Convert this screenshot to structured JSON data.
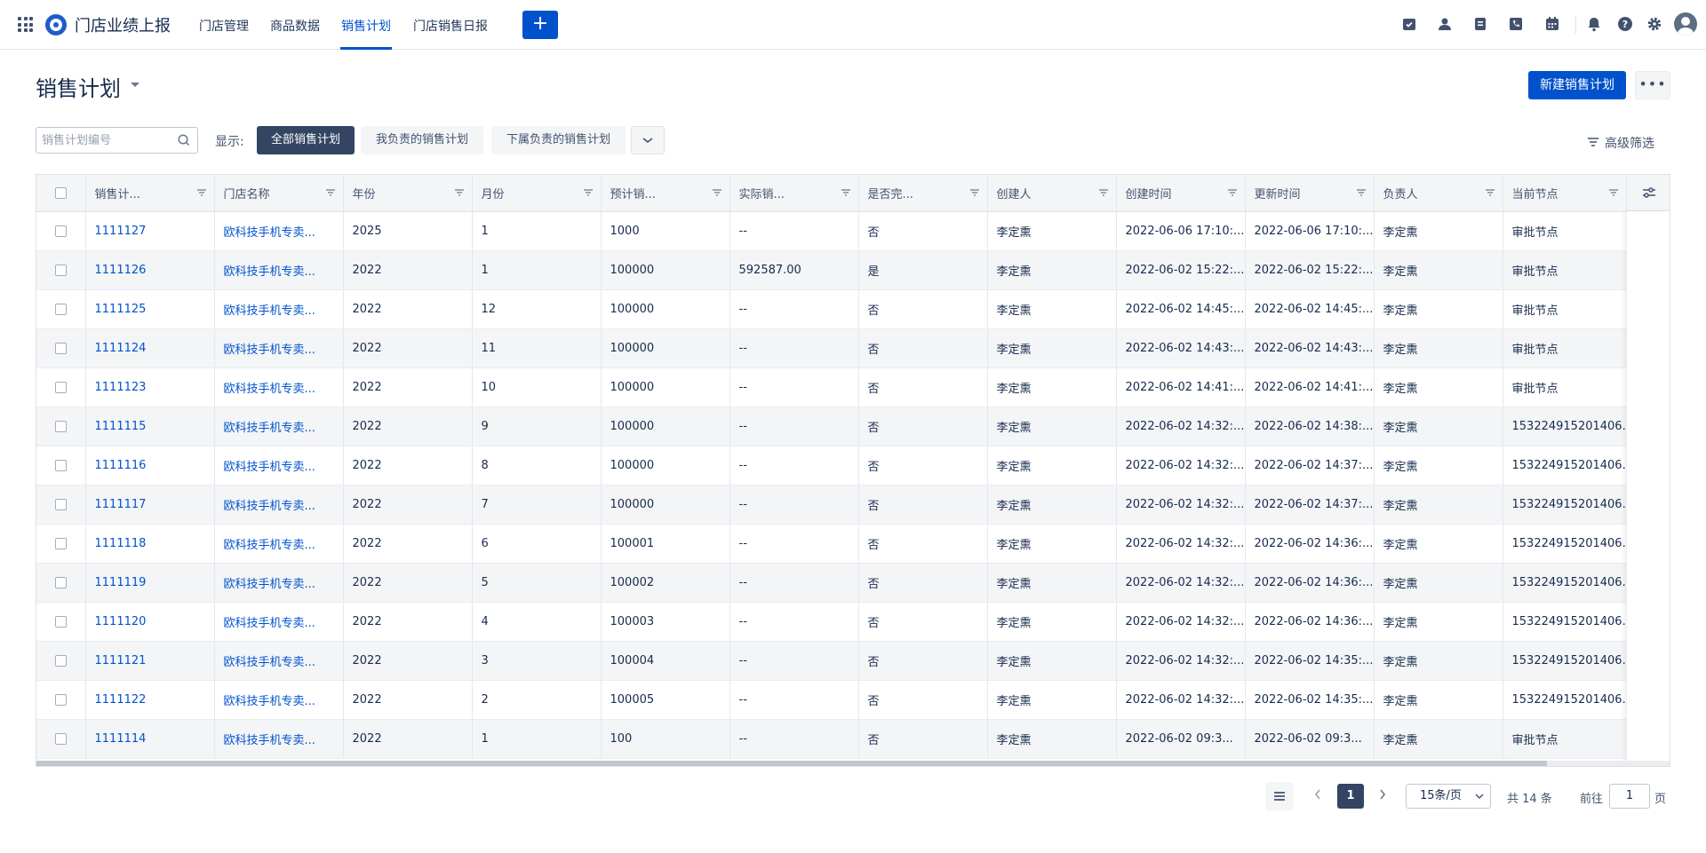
{
  "topnav": {
    "app_title": "门店业绩上报",
    "items": [
      {
        "label": "门店管理",
        "active": false
      },
      {
        "label": "商品数据",
        "active": false
      },
      {
        "label": "销售计划",
        "active": true
      },
      {
        "label": "门店销售日报",
        "active": false
      }
    ],
    "add_label": "+",
    "icons": [
      "task-icon",
      "contacts-icon",
      "document-icon",
      "phone-icon",
      "calendar-icon",
      "bell-icon",
      "help-icon",
      "settings-icon"
    ]
  },
  "header": {
    "title": "销售计划",
    "new_button": "新建销售计划",
    "more_button": "•••"
  },
  "filters": {
    "search_placeholder": "销售计划编号",
    "show_label": "显示:",
    "segments": [
      "全部销售计划",
      "我负责的销售计划",
      "下属负责的销售计划"
    ],
    "active_segment": 0,
    "advanced_filter": "高级筛选"
  },
  "table": {
    "columns": [
      "销售计...",
      "门店名称",
      "年份",
      "月份",
      "预计销...",
      "实际销...",
      "是否完...",
      "创建人",
      "创建时间",
      "更新时间",
      "负责人",
      "当前节点"
    ],
    "rows": [
      [
        "1111127",
        "欧科技手机专卖...",
        "2025",
        "1",
        "1000",
        "--",
        "否",
        "李定熏",
        "2022-06-06 17:10:...",
        "2022-06-06 17:10:...",
        "李定熏",
        "审批节点"
      ],
      [
        "1111126",
        "欧科技手机专卖...",
        "2022",
        "1",
        "100000",
        "592587.00",
        "是",
        "李定熏",
        "2022-06-02 15:22:...",
        "2022-06-02 15:22:...",
        "李定熏",
        "审批节点"
      ],
      [
        "1111125",
        "欧科技手机专卖...",
        "2022",
        "12",
        "100000",
        "--",
        "否",
        "李定熏",
        "2022-06-02 14:45:...",
        "2022-06-02 14:45:...",
        "李定熏",
        "审批节点"
      ],
      [
        "1111124",
        "欧科技手机专卖...",
        "2022",
        "11",
        "100000",
        "--",
        "否",
        "李定熏",
        "2022-06-02 14:43:...",
        "2022-06-02 14:43:...",
        "李定熏",
        "审批节点"
      ],
      [
        "1111123",
        "欧科技手机专卖...",
        "2022",
        "10",
        "100000",
        "--",
        "否",
        "李定熏",
        "2022-06-02 14:41:...",
        "2022-06-02 14:41:...",
        "李定熏",
        "审批节点"
      ],
      [
        "1111115",
        "欧科技手机专卖...",
        "2022",
        "9",
        "100000",
        "--",
        "否",
        "李定熏",
        "2022-06-02 14:32:...",
        "2022-06-02 14:38:...",
        "李定熏",
        "153224915201406..."
      ],
      [
        "1111116",
        "欧科技手机专卖...",
        "2022",
        "8",
        "100000",
        "--",
        "否",
        "李定熏",
        "2022-06-02 14:32:...",
        "2022-06-02 14:37:...",
        "李定熏",
        "153224915201406..."
      ],
      [
        "1111117",
        "欧科技手机专卖...",
        "2022",
        "7",
        "100000",
        "--",
        "否",
        "李定熏",
        "2022-06-02 14:32:...",
        "2022-06-02 14:37:...",
        "李定熏",
        "153224915201406..."
      ],
      [
        "1111118",
        "欧科技手机专卖...",
        "2022",
        "6",
        "100001",
        "--",
        "否",
        "李定熏",
        "2022-06-02 14:32:...",
        "2022-06-02 14:36:...",
        "李定熏",
        "153224915201406..."
      ],
      [
        "1111119",
        "欧科技手机专卖...",
        "2022",
        "5",
        "100002",
        "--",
        "否",
        "李定熏",
        "2022-06-02 14:32:...",
        "2022-06-02 14:36:...",
        "李定熏",
        "153224915201406..."
      ],
      [
        "1111120",
        "欧科技手机专卖...",
        "2022",
        "4",
        "100003",
        "--",
        "否",
        "李定熏",
        "2022-06-02 14:32:...",
        "2022-06-02 14:36:...",
        "李定熏",
        "153224915201406..."
      ],
      [
        "1111121",
        "欧科技手机专卖...",
        "2022",
        "3",
        "100004",
        "--",
        "否",
        "李定熏",
        "2022-06-02 14:32:...",
        "2022-06-02 14:35:...",
        "李定熏",
        "153224915201406..."
      ],
      [
        "1111122",
        "欧科技手机专卖...",
        "2022",
        "2",
        "100005",
        "--",
        "否",
        "李定熏",
        "2022-06-02 14:32:...",
        "2022-06-02 14:35:...",
        "李定熏",
        "153224915201406..."
      ],
      [
        "1111114",
        "欧科技手机专卖...",
        "2022",
        "1",
        "100",
        "--",
        "否",
        "李定熏",
        "2022-06-02 09:3...",
        "2022-06-02 09:3...",
        "李定熏",
        "审批节点"
      ]
    ]
  },
  "pagination": {
    "current_page": "1",
    "page_size": "15条/页",
    "total": "共 14 条",
    "goto_label": "前往",
    "goto_value": "1",
    "page_suffix": "页"
  },
  "colors": {
    "primary": "#0052cc",
    "active_segment": "#344563"
  }
}
